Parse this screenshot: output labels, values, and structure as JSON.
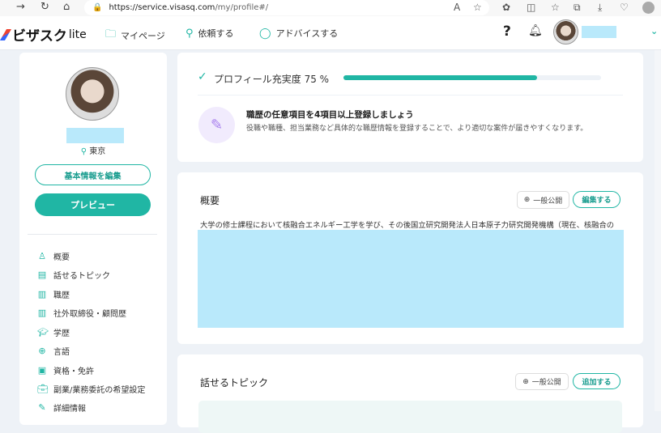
{
  "browser": {
    "url_host": "https://service.visasq.com",
    "url_path": "/my/profile#/"
  },
  "header": {
    "logo": "ビザスク",
    "logo_suffix": "lite",
    "nav": [
      {
        "label": "マイページ"
      },
      {
        "label": "依頼する"
      },
      {
        "label": "アドバイスする"
      }
    ],
    "help": "?"
  },
  "sidebar": {
    "location": "東京",
    "edit_button": "基本情報を編集",
    "preview_button": "プレビュー",
    "items": [
      {
        "label": "概要",
        "icon": "person-icon"
      },
      {
        "label": "話せるトピック",
        "icon": "document-icon"
      },
      {
        "label": "職歴",
        "icon": "building-icon"
      },
      {
        "label": "社外取締役・顧問歴",
        "icon": "building-icon"
      },
      {
        "label": "学歴",
        "icon": "graduation-cap-icon"
      },
      {
        "label": "言語",
        "icon": "globe-icon"
      },
      {
        "label": "資格・免許",
        "icon": "certificate-icon"
      },
      {
        "label": "副業/業務委託の希望設定",
        "icon": "briefcase-icon"
      },
      {
        "label": "詳細情報",
        "icon": "edit-icon"
      }
    ]
  },
  "profile_completion": {
    "label": "プロフィール充実度 75 %",
    "percent": 75,
    "tip_title": "職歴の任意項目を4項目以上登録しましょう",
    "tip_body": "役職や職種、担当業務など具体的な職歴情報を登録することで、より適切な案件が届きやすくなります。"
  },
  "summary": {
    "title": "概要",
    "visibility": "一般公開",
    "edit_button": "編集する",
    "text": "大学の修士課程において核融合エネルギー工学を学び、その後国立研究開発法人日本原子力研究開発機構（現在、核融合の"
  },
  "topics": {
    "title": "話せるトピック",
    "visibility": "一般公開",
    "add_button": "追加する"
  },
  "colors": {
    "accent": "#20b6a4",
    "redaction": "#b9e9fb"
  }
}
